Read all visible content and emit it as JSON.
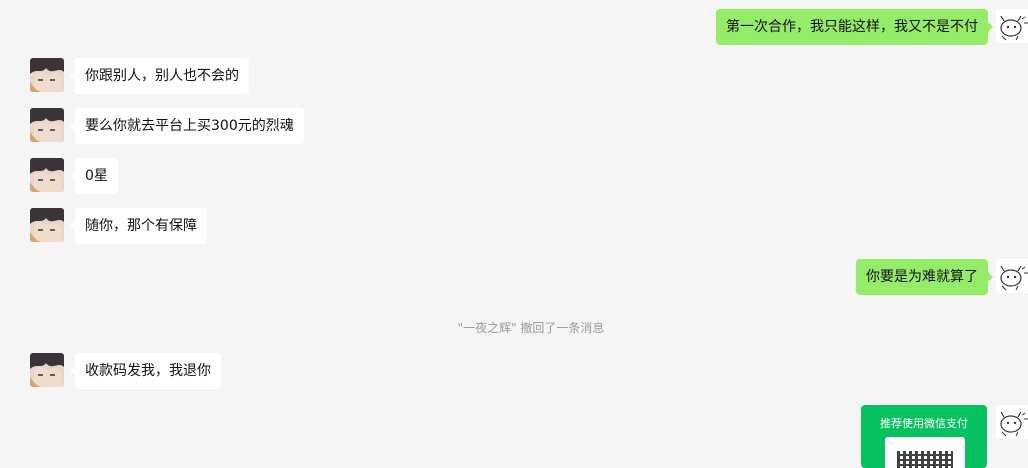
{
  "messages": [
    {
      "side": "right",
      "text": "第一次合作，我只能这样，我又不是不付"
    },
    {
      "side": "left",
      "text": "你跟别人，别人也不会的"
    },
    {
      "side": "left",
      "text": "要么你就去平台上买300元的烈魂"
    },
    {
      "side": "left",
      "text": "0星"
    },
    {
      "side": "left",
      "text": "随你，那个有保障"
    },
    {
      "side": "right",
      "text": "你要是为难就算了"
    },
    {
      "side": "left",
      "text": "收款码发我，我退你"
    }
  ],
  "system_notice": "\"一夜之辉\" 撤回了一条消息",
  "pay_card": {
    "title": "推荐使用微信支付"
  },
  "colors": {
    "background": "#f5f5f5",
    "own_bubble": "#95ec69",
    "other_bubble": "#ffffff",
    "pay_card": "#07c160"
  }
}
